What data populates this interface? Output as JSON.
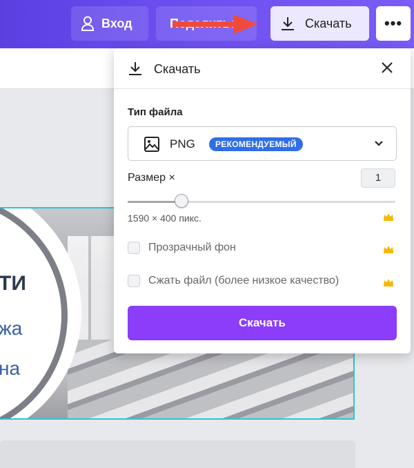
{
  "topbar": {
    "login_label": "Вход",
    "share_label": "Поделиться",
    "download_label": "Скачать",
    "more_label": "•••"
  },
  "design": {
    "line1": "ТИ",
    "line2": "жа",
    "line3": "на"
  },
  "popup": {
    "title": "Скачать",
    "file_type_label": "Тип файла",
    "file_type_value": "PNG",
    "recommended_badge": "РЕКОМЕНДУЕМЫЙ",
    "size_label": "Размер ×",
    "size_value": "1",
    "size_slider_fraction": 0.2,
    "dimensions_text": "1590 × 400 пикс.",
    "transparent_bg_label": "Прозрачный фон",
    "compress_label": "Сжать файл (более низкое качество)",
    "download_button": "Скачать"
  },
  "colors": {
    "accent": "#8b3dfa",
    "badge": "#2f6ee8",
    "crown": "#f5b800",
    "annotation_arrow": "#f04a3c"
  },
  "icons": [
    "user-icon",
    "download-icon",
    "more-icon",
    "close-icon",
    "image-icon",
    "chevron-down-icon",
    "crown-icon"
  ]
}
